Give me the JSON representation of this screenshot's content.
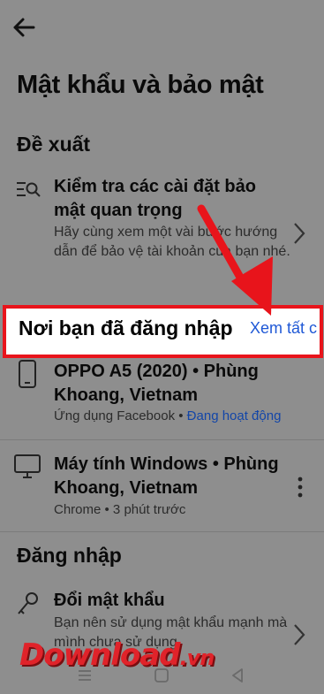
{
  "header": {
    "back_icon": "arrow-left-icon"
  },
  "page_title": "Mật khẩu và bảo mật",
  "suggestions": {
    "title": "Đề xuất",
    "item": {
      "icon": "search-list-icon",
      "title": "Kiểm tra các cài đặt bảo mật quan trọng",
      "subtitle": "Hãy cùng xem một vài bước hướng dẫn để bảo vệ tài khoản của bạn nhé."
    }
  },
  "where_logged_in": {
    "title": "Nơi bạn đã đăng nhập",
    "see_all": "Xem tất c",
    "devices": [
      {
        "icon": "phone-icon",
        "name": "OPPO A5 (2020) • Phùng Khoang, Vietnam",
        "app": "Ứng dụng Facebook",
        "separator": " • ",
        "status": "Đang hoạt động"
      },
      {
        "icon": "desktop-icon",
        "name": "Máy tính Windows • Phùng Khoang, Vietnam",
        "meta": "Chrome • 3 phút trước"
      }
    ]
  },
  "login": {
    "title": "Đăng nhập",
    "item": {
      "icon": "key-icon",
      "title": "Đổi mật khẩu",
      "subtitle": "Bạn nên sử dụng mật khẩu mạnh mà mình chưa sử dụng"
    }
  },
  "watermark": {
    "main": "Download",
    "suffix": ".vn"
  },
  "colors": {
    "dim_background": "#8e8e8e",
    "highlight_border": "#e8141b",
    "link_blue": "#1f58d6",
    "active_status": "#1346a8"
  }
}
